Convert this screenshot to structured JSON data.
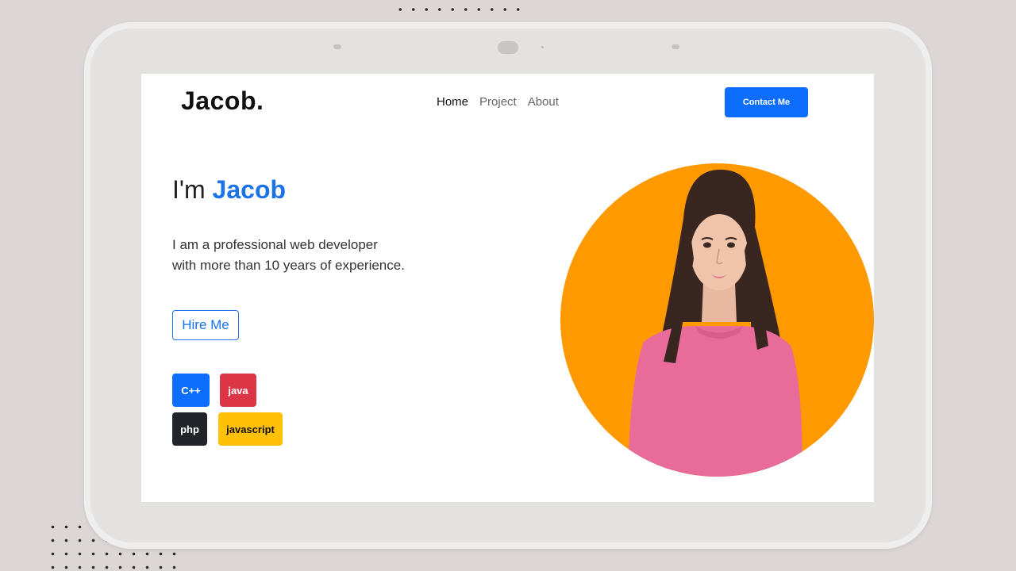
{
  "site": {
    "logo": "Jacob.",
    "nav": [
      {
        "label": "Home",
        "active": true
      },
      {
        "label": "Project",
        "active": false
      },
      {
        "label": "About",
        "active": false
      }
    ],
    "contact_label": "Contact Me"
  },
  "hero": {
    "greeting": "I'm ",
    "name": "Jacob",
    "description_line1": "I am a professional web developer",
    "description_line2": "with more than 10 years of experience.",
    "hire_label": "Hire Me"
  },
  "skills": [
    {
      "label": "C++",
      "color": "#0d6efd"
    },
    {
      "label": "java",
      "color": "#dc3545"
    },
    {
      "label": "php",
      "color": "#212529"
    },
    {
      "label": "javascript",
      "color": "#ffc107"
    }
  ],
  "colors": {
    "accent": "#0d6efd",
    "portrait_bg": "#ff9900",
    "sweater": "#e96b9a",
    "hair": "#3a2620"
  }
}
